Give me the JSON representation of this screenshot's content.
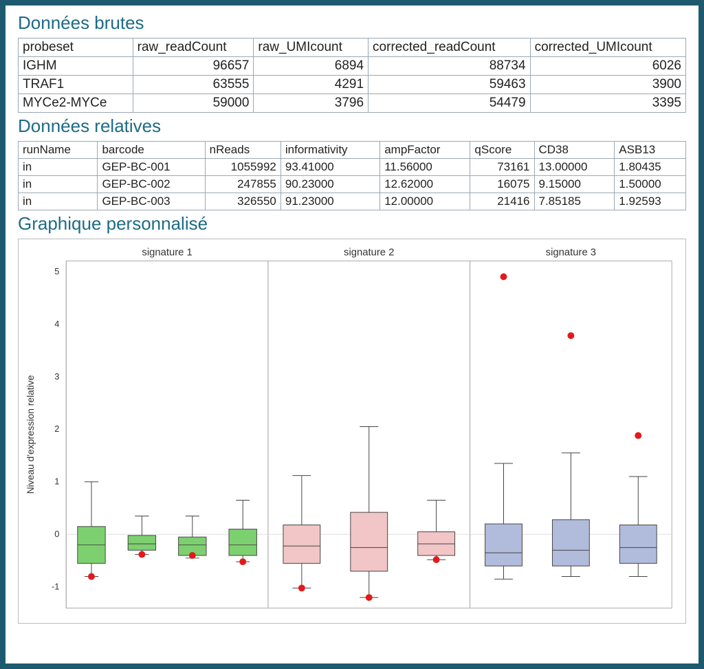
{
  "sections": {
    "raw_title": "Données brutes",
    "rel_title": "Données relatives",
    "chart_title": "Graphique personnalisé"
  },
  "raw_table": {
    "headers": [
      "probeset",
      "raw_readCount",
      "raw_UMIcount",
      "corrected_readCount",
      "corrected_UMIcount"
    ],
    "rows": [
      {
        "probeset": "IGHM",
        "raw_readCount": "96657",
        "raw_UMIcount": "6894",
        "corrected_readCount": "88734",
        "corrected_UMIcount": "6026"
      },
      {
        "probeset": "TRAF1",
        "raw_readCount": "63555",
        "raw_UMIcount": "4291",
        "corrected_readCount": "59463",
        "corrected_UMIcount": "3900"
      },
      {
        "probeset": "MYCe2-MYCe",
        "raw_readCount": "59000",
        "raw_UMIcount": "3796",
        "corrected_readCount": "54479",
        "corrected_UMIcount": "3395"
      }
    ]
  },
  "rel_table": {
    "headers": [
      "runName",
      "barcode",
      "nReads",
      "informativity",
      "ampFactor",
      "qScore",
      "CD38",
      "ASB13"
    ],
    "rows": [
      {
        "runName": "in",
        "barcode": "GEP-BC-001",
        "nReads": "1055992",
        "informativity": "93.41000",
        "ampFactor": "11.56000",
        "qScore": "73161",
        "CD38": "13.00000",
        "ASB13": "1.80435"
      },
      {
        "runName": "in",
        "barcode": "GEP-BC-002",
        "nReads": "247855",
        "informativity": "90.23000",
        "ampFactor": "12.62000",
        "qScore": "16075",
        "CD38": "9.15000",
        "ASB13": "1.50000"
      },
      {
        "runName": "in",
        "barcode": "GEP-BC-003",
        "nReads": "326550",
        "informativity": "91.23000",
        "ampFactor": "12.00000",
        "qScore": "21416",
        "CD38": "7.85185",
        "ASB13": "1.92593"
      }
    ]
  },
  "chart_data": {
    "type": "boxplot",
    "ylabel": "Niveau d'expression relative",
    "ylim": [
      -1.4,
      5.2
    ],
    "yticks": [
      -1,
      0,
      1,
      2,
      3,
      4,
      5
    ],
    "panels": [
      {
        "label": "signature 1",
        "color": "#7dd06f",
        "boxes": [
          {
            "q1": -0.55,
            "median": -0.2,
            "q3": 0.15,
            "wlo": -0.8,
            "whi": 1.0,
            "outlier": -0.8
          },
          {
            "q1": -0.3,
            "median": -0.18,
            "q3": -0.02,
            "wlo": -0.38,
            "whi": 0.35,
            "outlier": -0.38
          },
          {
            "q1": -0.4,
            "median": -0.2,
            "q3": -0.05,
            "wlo": -0.45,
            "whi": 0.35,
            "outlier": -0.4
          },
          {
            "q1": -0.4,
            "median": -0.2,
            "q3": 0.1,
            "wlo": -0.52,
            "whi": 0.65,
            "outlier": -0.52
          }
        ]
      },
      {
        "label": "signature 2",
        "color": "#f2c6c6",
        "boxes": [
          {
            "q1": -0.55,
            "median": -0.22,
            "q3": 0.18,
            "wlo": -1.02,
            "whi": 1.12,
            "outlier": -1.02
          },
          {
            "q1": -0.7,
            "median": -0.25,
            "q3": 0.42,
            "wlo": -1.2,
            "whi": 2.05,
            "outlier": -1.2
          },
          {
            "q1": -0.4,
            "median": -0.18,
            "q3": 0.05,
            "wlo": -0.48,
            "whi": 0.65,
            "outlier": -0.48
          }
        ]
      },
      {
        "label": "signature 3",
        "color": "#b1bbdc",
        "boxes": [
          {
            "q1": -0.6,
            "median": -0.35,
            "q3": 0.2,
            "wlo": -0.85,
            "whi": 1.35,
            "outlier": 4.9
          },
          {
            "q1": -0.6,
            "median": -0.3,
            "q3": 0.28,
            "wlo": -0.8,
            "whi": 1.55,
            "outlier": 3.78
          },
          {
            "q1": -0.55,
            "median": -0.25,
            "q3": 0.18,
            "wlo": -0.8,
            "whi": 1.1,
            "outlier": 1.88
          }
        ]
      }
    ]
  }
}
